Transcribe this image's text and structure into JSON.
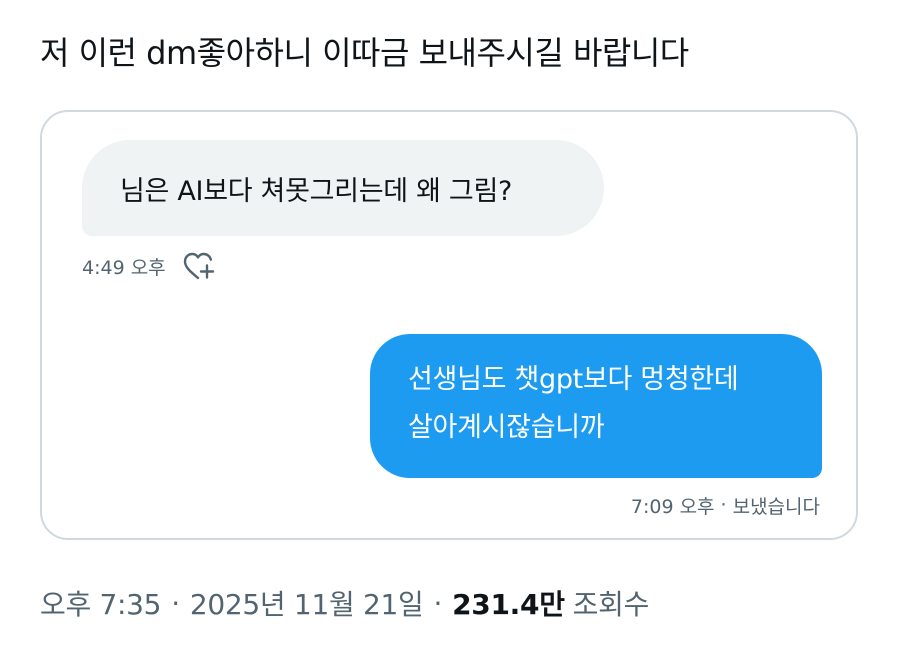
{
  "post": {
    "text": "저 이런 dm좋아하니 이따금 보내주시길 바랍니다"
  },
  "dm": {
    "received": {
      "text": "님은 AI보다 쳐못그리는데 왜 그림?",
      "time": "4:49 오후",
      "reaction_icon": "heart-plus-icon"
    },
    "sent": {
      "line1": "선생님도 챗gpt보다 멍청한데",
      "line2": "살아계시잖습니까",
      "time": "7:09 오후",
      "separator": "·",
      "status": "보냈습니다"
    }
  },
  "footer": {
    "time": "오후 7:35",
    "separator1": "·",
    "date": "2025년 11월 21일",
    "separator2": "·",
    "views_count": "231.4만",
    "views_label": "조회수"
  },
  "colors": {
    "accent": "#1d9bf0",
    "received_bubble": "#eff3f4",
    "muted_text": "#536471",
    "card_border": "#cfd9de"
  }
}
